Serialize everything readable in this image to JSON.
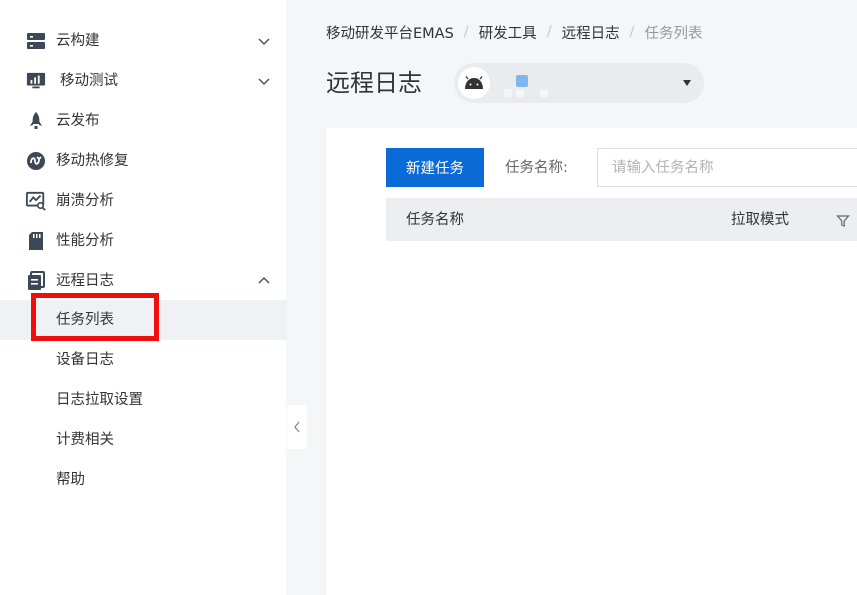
{
  "sidebar": {
    "items": [
      {
        "label": "云构建",
        "icon": "server-icon",
        "expandable": true,
        "expanded": false
      },
      {
        "label": "移动测试",
        "icon": "monitor-chart-icon",
        "expandable": true,
        "expanded": false
      },
      {
        "label": "云发布",
        "icon": "rocket-icon",
        "expandable": false
      },
      {
        "label": "移动热修复",
        "icon": "hotfix-icon",
        "expandable": false
      },
      {
        "label": "崩溃分析",
        "icon": "crash-analysis-icon",
        "expandable": false
      },
      {
        "label": "性能分析",
        "icon": "sd-card-icon",
        "expandable": false
      },
      {
        "label": "远程日志",
        "icon": "document-icon",
        "expandable": true,
        "expanded": true
      }
    ],
    "sub_items": [
      {
        "label": "任务列表",
        "active": true
      },
      {
        "label": "设备日志",
        "active": false
      },
      {
        "label": "日志拉取设置",
        "active": false
      },
      {
        "label": "计费相关",
        "active": false
      },
      {
        "label": "帮助",
        "active": false
      }
    ]
  },
  "breadcrumb": [
    "移动研发平台EMAS",
    "研发工具",
    "远程日志",
    "任务列表"
  ],
  "page_title": "远程日志",
  "app_selector": {
    "platform_icon": "android-icon"
  },
  "toolbar": {
    "new_task_label": "新建任务",
    "filter_label": "任务名称:",
    "search_placeholder": "请输入任务名称",
    "search_value": ""
  },
  "table": {
    "columns": [
      "任务名称",
      "拉取模式"
    ]
  },
  "colors": {
    "primary": "#0a6bd6",
    "highlight": "#f20d0d",
    "active_bg": "#eff1f4"
  }
}
